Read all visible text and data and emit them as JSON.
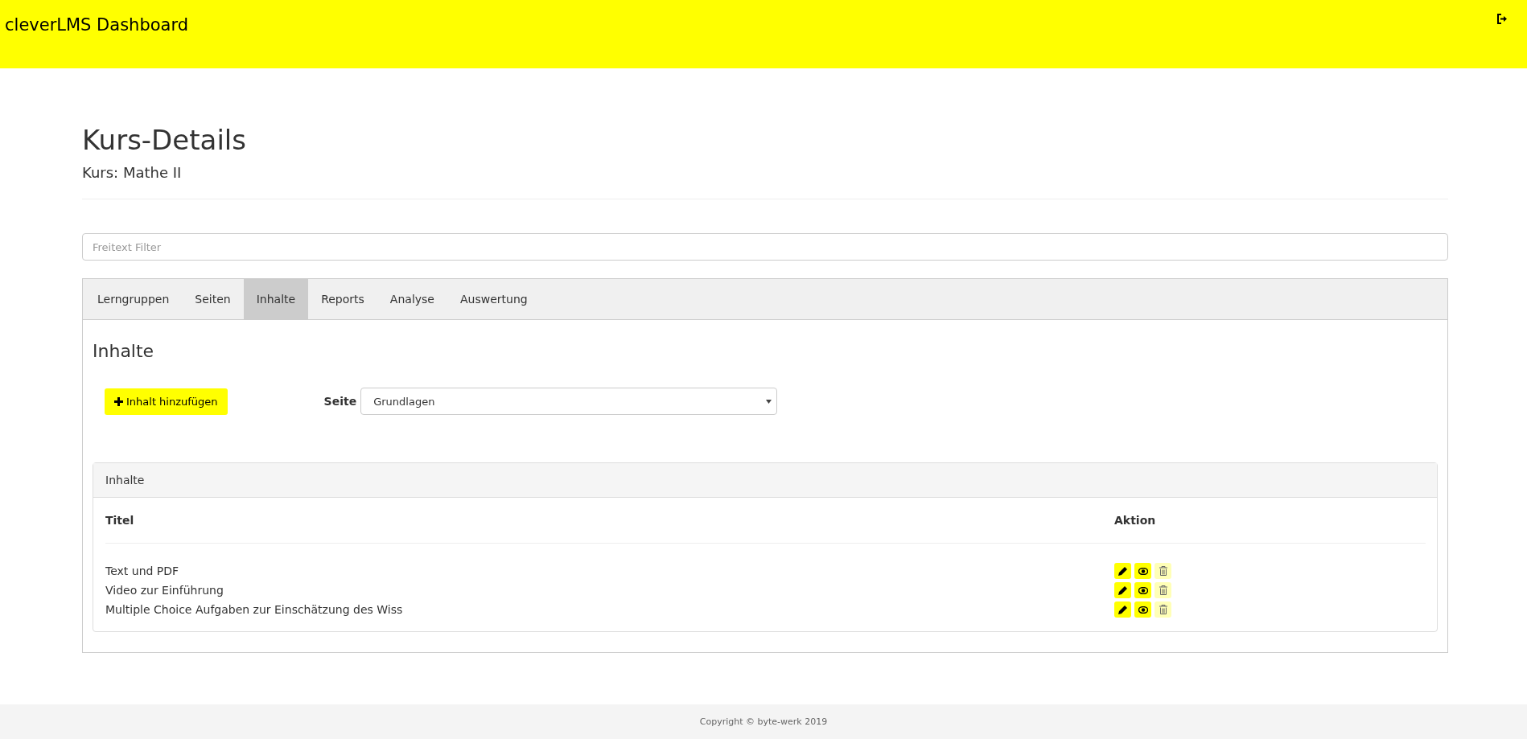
{
  "navbar": {
    "brand": "cleverLMS Dashboard"
  },
  "page": {
    "title": "Kurs-Details",
    "subtitle": "Kurs: Mathe II"
  },
  "filter": {
    "placeholder": "Freitext Filter"
  },
  "tabs": [
    {
      "label": "Lerngruppen",
      "selected": false
    },
    {
      "label": "Seiten",
      "selected": false
    },
    {
      "label": "Inhalte",
      "selected": true
    },
    {
      "label": "Reports",
      "selected": false
    },
    {
      "label": "Analyse",
      "selected": false
    },
    {
      "label": "Auswertung",
      "selected": false
    }
  ],
  "section": {
    "title": "Inhalte",
    "add_button": "Inhalt hinzufügen",
    "page_label": "Seite",
    "page_select": "Grundlagen"
  },
  "table_panel": {
    "heading": "Inhalte",
    "columns": [
      "Titel",
      "Aktion"
    ],
    "rows": [
      {
        "title": "Text und PDF",
        "actions": [
          {
            "kind": "edit",
            "disabled": false
          },
          {
            "kind": "view",
            "disabled": false
          },
          {
            "kind": "delete",
            "disabled": true
          }
        ]
      },
      {
        "title": "Video zur Einführung",
        "actions": [
          {
            "kind": "edit",
            "disabled": false
          },
          {
            "kind": "view",
            "disabled": false
          },
          {
            "kind": "delete",
            "disabled": true
          }
        ]
      },
      {
        "title": "Multiple Choice Aufgaben zur Einschätzung des Wiss",
        "actions": [
          {
            "kind": "edit",
            "disabled": false
          },
          {
            "kind": "view",
            "disabled": false
          },
          {
            "kind": "delete",
            "disabled": true
          }
        ]
      }
    ]
  },
  "footer": {
    "text": "Copyright © byte-werk 2019"
  }
}
